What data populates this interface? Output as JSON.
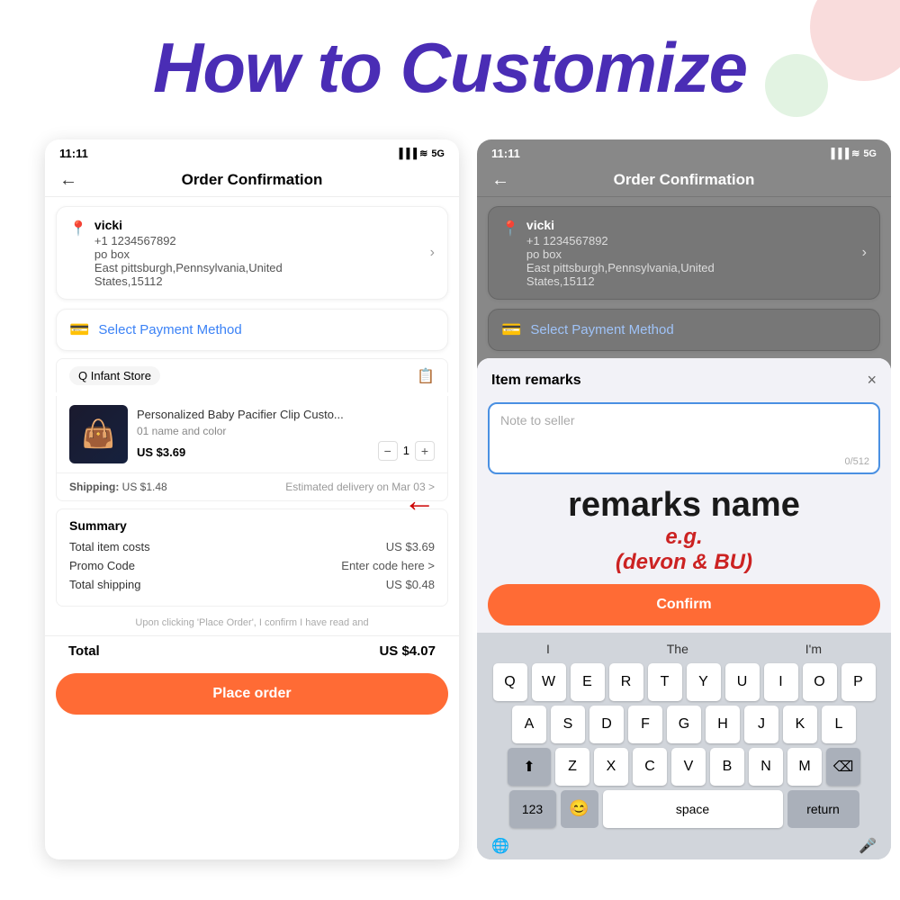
{
  "title": "How to Customize",
  "left_phone": {
    "status_bar": {
      "time": "11:11",
      "icons": "▐▐▐ ≋ 5G"
    },
    "nav": {
      "back": "←",
      "title": "Order Confirmation"
    },
    "address": {
      "name": "vicki",
      "phone": "+1 1234567892",
      "address1": "po box",
      "address2": "East pittsburgh,Pennsylvania,United",
      "address3": "States,15112"
    },
    "payment": "Select Payment Method",
    "store": {
      "name": "Q Infant Store",
      "icon": "🏪"
    },
    "product": {
      "name": "Personalized Baby Pacifier Clip Custo...",
      "variant": "01 name and color",
      "price": "US $3.69",
      "qty": "1"
    },
    "shipping": {
      "label": "Shipping:",
      "cost": "US $1.48",
      "delivery": "Estimated delivery on Mar 03 >"
    },
    "summary": {
      "title": "Summary",
      "item_costs_label": "Total item costs",
      "item_costs_value": "US $3.69",
      "promo_label": "Promo Code",
      "promo_value": "Enter code here >",
      "shipping_label": "Total shipping",
      "shipping_value": "US $0.48"
    },
    "disclaimer": "Upon clicking 'Place Order', I confirm I have read and",
    "total_label": "Total",
    "total_value": "US $4.07",
    "place_order": "Place order"
  },
  "right_phone": {
    "status_bar": {
      "time": "11:11",
      "icons": "▐▐▐ ≋ 5G"
    },
    "nav": {
      "back": "←",
      "title": "Order Confirmation"
    },
    "address": {
      "name": "vicki",
      "phone": "+1 1234567892",
      "address1": "po box",
      "address2": "East pittsburgh,Pennsylvania,United",
      "address3": "States,15112"
    },
    "payment": "Select Payment Method"
  },
  "remarks_popup": {
    "title": "Item remarks",
    "close": "×",
    "placeholder": "Note to seller",
    "counter": "0/512",
    "confirm": "Confirm",
    "overlay_line1": "remarks name",
    "overlay_line2": "e.g.",
    "overlay_line3": "(devon & BU)"
  },
  "keyboard": {
    "suggestions": [
      "I",
      "The",
      "I'm"
    ],
    "row1": [
      "Q",
      "W",
      "E",
      "R",
      "T",
      "Y",
      "U",
      "I",
      "O",
      "P"
    ],
    "row2": [
      "A",
      "S",
      "D",
      "F",
      "G",
      "H",
      "J",
      "K",
      "L"
    ],
    "row3": [
      "Z",
      "X",
      "C",
      "V",
      "B",
      "N",
      "M"
    ],
    "space": "space",
    "return": "return",
    "numbers": "123",
    "delete": "⌫",
    "globe": "🌐",
    "mic": "🎤"
  }
}
